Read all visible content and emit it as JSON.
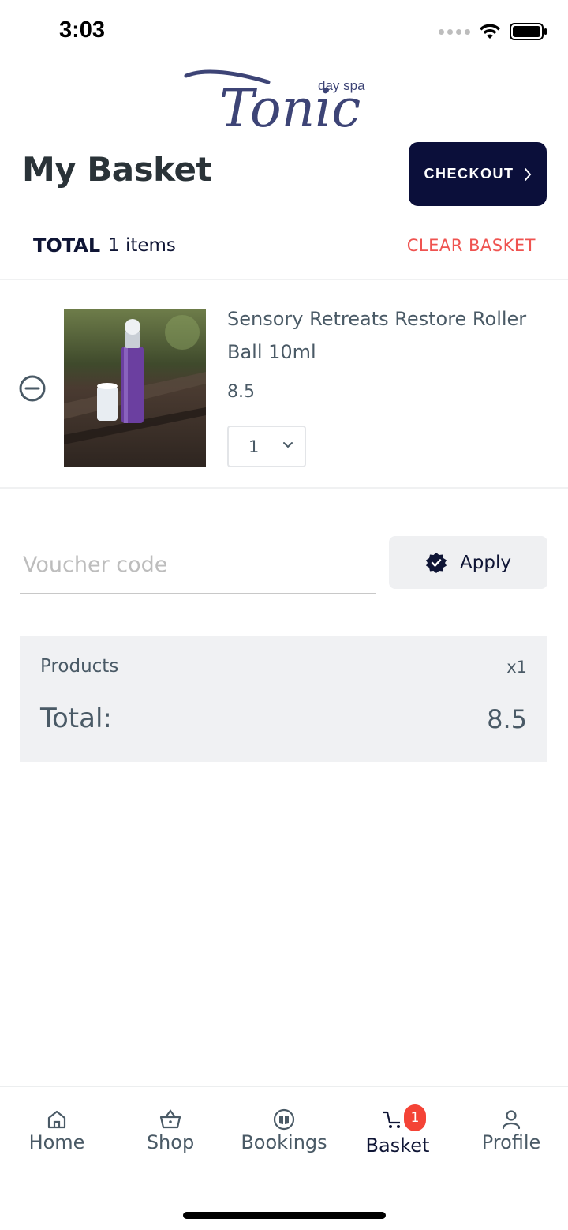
{
  "status_bar": {
    "time": "3:03"
  },
  "brand": {
    "logo_text": "Tonic",
    "logo_subtext": "day spa",
    "color": "#3d4476"
  },
  "header": {
    "title": "My Basket",
    "checkout_label": "CHECKOUT"
  },
  "basket": {
    "total_label": "TOTAL",
    "items_count": "1 items",
    "clear_label": "CLEAR BASKET",
    "items": [
      {
        "name": "Sensory Retreats Restore Roller Ball 10ml",
        "price": "8.5",
        "quantity": "1"
      }
    ]
  },
  "voucher": {
    "placeholder": "Voucher code",
    "apply_label": "Apply"
  },
  "summary": {
    "products_label": "Products",
    "products_count": "x1",
    "total_label": "Total:",
    "total_value": "8.5"
  },
  "tabs": [
    {
      "label": "Home",
      "icon": "home-icon"
    },
    {
      "label": "Shop",
      "icon": "basket-icon"
    },
    {
      "label": "Bookings",
      "icon": "book-icon"
    },
    {
      "label": "Basket",
      "icon": "cart-icon",
      "badge": "1",
      "active": true
    },
    {
      "label": "Profile",
      "icon": "person-icon"
    }
  ],
  "colors": {
    "accent": "#0b0f3a",
    "danger": "#ef5350",
    "badge": "#f44336",
    "muted_text": "#4a5a66"
  }
}
